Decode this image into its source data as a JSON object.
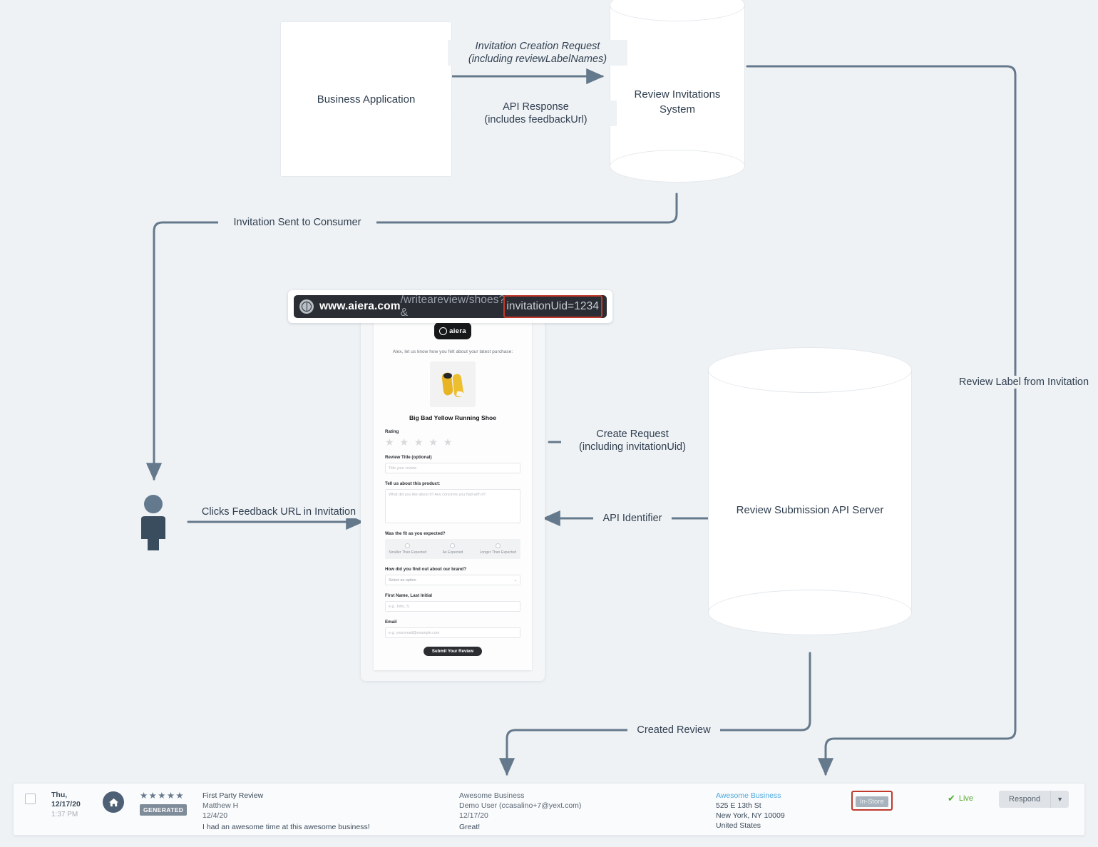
{
  "diagram": {
    "nodes": {
      "business_application": "Business Application",
      "review_invitations_system": "Review Invitations\nSystem",
      "review_submission_api_server": "Review Submission API Server"
    },
    "edges": {
      "invitation_creation_request": "Invitation Creation Request\n(including reviewLabelNames)",
      "api_response": "API Response\n(includes feedbackUrl)",
      "invitation_sent_to_consumer": "Invitation Sent to Consumer",
      "clicks_feedback_url": "Clicks Feedback URL in Invitation",
      "create_request": "Create Request\n(including invitationUid)",
      "api_identifier": "API Identifier",
      "review_label_from_invitation": "Review Label from Invitation",
      "created_review": "Created Review"
    },
    "colors": {
      "background": "#eef2f5",
      "connector": "#65798c",
      "highlight": "#c0392b",
      "person": "#3a4d5e",
      "node_fill": "#ffffff"
    }
  },
  "browser": {
    "icon": "globe-icon",
    "url_host": "www.aiera.com",
    "url_path": "/writeareview/shoes?&",
    "url_param": "invitationUid=1234"
  },
  "review_form": {
    "brand": "aiera",
    "greeting": "Alex, let us know how you felt about your latest purchase:",
    "product_name": "Big Bad Yellow Running Shoe",
    "rating_label": "Rating",
    "rating_stars": "★ ★ ★ ★ ★",
    "title_label": "Review Title (optional)",
    "title_placeholder": "Title your review",
    "about_label": "Tell us about this product:",
    "about_placeholder": "What did you like about it? Any concerns you had with it?",
    "fit_label": "Was the fit as you expected?",
    "fit_options": [
      "Smaller Than Expected",
      "As Expected",
      "Longer Than Expected"
    ],
    "brand_source_label": "How did you find out about our brand?",
    "brand_source_value": "Select an option",
    "name_label": "First Name, Last Initial",
    "name_placeholder": "e.g. John, S",
    "email_label": "Email",
    "email_placeholder": "e.g. youremail@example.com",
    "submit_label": "Submit Your Review"
  },
  "review_row": {
    "checkbox_checked": false,
    "date_line1": "Thu,",
    "date_line2": "12/17/20",
    "time": "1:37 PM",
    "source_icon": "home-icon",
    "stars": "★★★★★",
    "badge": "GENERATED",
    "review_title": "First Party Review",
    "reviewer": "Matthew H",
    "review_date": "12/4/20",
    "review_text": "I had an awesome time at this awesome business!",
    "response_business": "Awesome Business",
    "response_user": "Demo User (ccasalino+7@yext.com)",
    "response_date": "12/17/20",
    "response_text": "Great!",
    "entity_name": "Awesome Business",
    "entity_address1": "525 E 13th St",
    "entity_address2": "New York, NY 10009",
    "entity_country": "United States",
    "label": "In-Store",
    "status": "Live",
    "status_icon": "check-icon",
    "respond_label": "Respond",
    "respond_caret": "chevron-down-icon"
  }
}
